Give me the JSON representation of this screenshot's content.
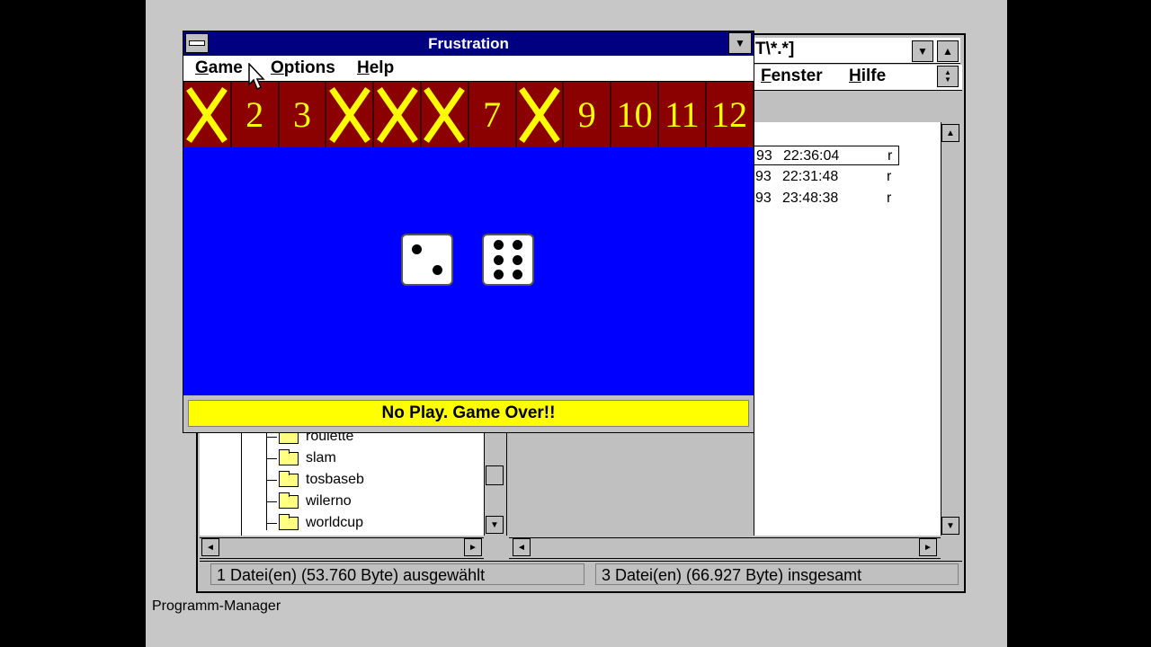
{
  "file_manager": {
    "title_fragment": "T\\*.*]",
    "menu": {
      "fenster_u": "F",
      "fenster_rest": "enster",
      "hilfe_u": "H",
      "hilfe_rest": "ilfe"
    },
    "files": [
      {
        "date": "93",
        "time": "22:36:04",
        "attr": "r",
        "selected": true
      },
      {
        "date": "93",
        "time": "22:31:48",
        "attr": "r",
        "selected": false
      },
      {
        "date": "93",
        "time": "23:48:38",
        "attr": "r",
        "selected": false
      }
    ],
    "tree": [
      "roulette",
      "slam",
      "tosbaseb",
      "wilerno",
      "worldcup"
    ],
    "status_left": "1 Datei(en) (53.760 Byte) ausgewählt",
    "status_right": "3 Datei(en) (66.927 Byte) insgesamt"
  },
  "frustration": {
    "title": "Frustration",
    "menu": {
      "game_u": "G",
      "game_rest": "ame",
      "options_u": "O",
      "options_rest": "ptions",
      "help_u": "H",
      "help_rest": "elp"
    },
    "tiles": [
      "X",
      "2",
      "3",
      "X",
      "X",
      "X",
      "7",
      "X",
      "9",
      "10",
      "11",
      "12"
    ],
    "dice": [
      2,
      6
    ],
    "status": "No Play. Game Over!!"
  },
  "taskbar": {
    "program_manager": "Programm-Manager"
  },
  "colors": {
    "title_bar": "#000080",
    "tile_bg": "#8b0000",
    "tile_fg": "#ffff00",
    "field": "#0000ff",
    "status_bg": "#ffff00"
  }
}
